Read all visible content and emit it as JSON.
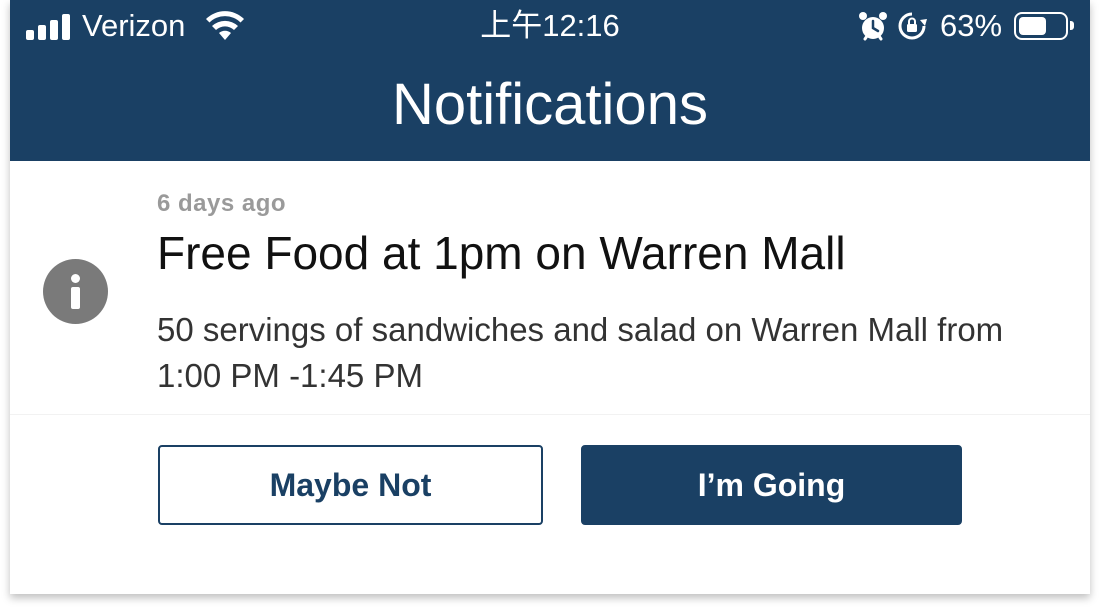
{
  "status_bar": {
    "carrier": "Verizon",
    "time": "上午12:16",
    "battery_percent": "63%",
    "battery_level": 0.63
  },
  "nav": {
    "title": "Notifications"
  },
  "notification": {
    "timestamp": "6 days ago",
    "title": "Free Food at 1pm on Warren Mall",
    "body": "50 servings of sandwiches and salad on Warren Mall from 1:00 PM -1:45 PM",
    "icon": "info-icon"
  },
  "actions": {
    "maybe_label": "Maybe Not",
    "going_label": "I’m Going"
  },
  "colors": {
    "brand": "#1a4064",
    "icon_gray": "#7a7a7a",
    "muted_text": "#9a9a9a"
  }
}
